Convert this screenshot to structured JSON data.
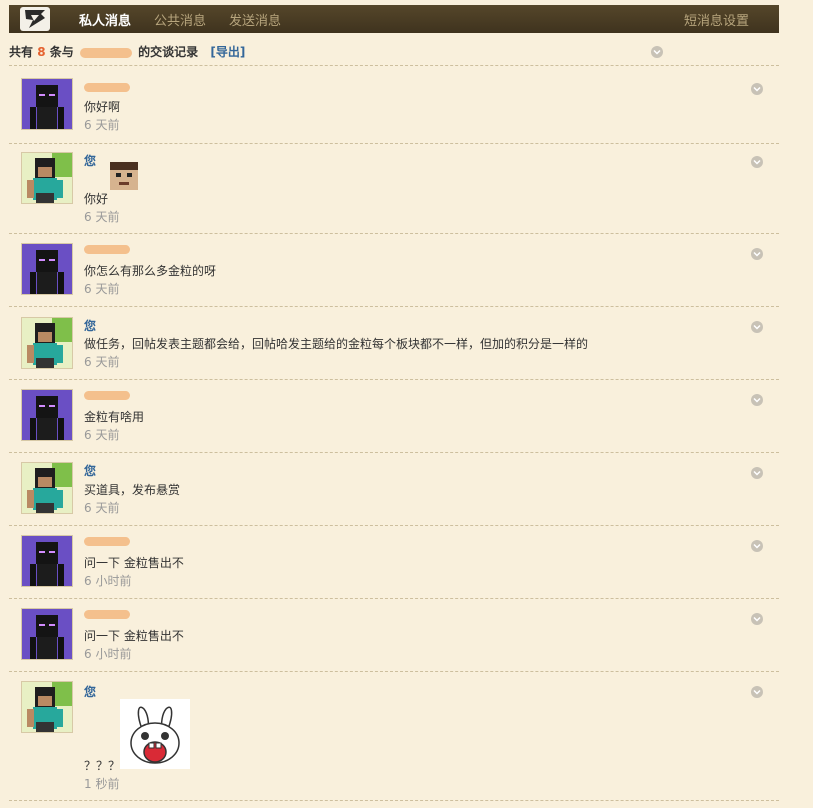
{
  "nav": {
    "tabs": [
      {
        "label": "私人消息",
        "active": true
      },
      {
        "label": "公共消息",
        "active": false
      },
      {
        "label": "发送消息",
        "active": false
      }
    ],
    "settings_label": "短消息设置"
  },
  "summary": {
    "prefix": "共有",
    "count": "8",
    "middle": "条与",
    "suffix": "的交谈记录",
    "export_label": "[导出]"
  },
  "messages": [
    {
      "sender": "",
      "sender_redacted": true,
      "avatar": "enderman-avatar",
      "text": "你好啊",
      "time": "6 天前"
    },
    {
      "sender": "您",
      "sender_redacted": false,
      "avatar": "steve-avatar",
      "text": "你好",
      "emote": "blocky-face-emote",
      "time": "6 天前"
    },
    {
      "sender": "",
      "sender_redacted": true,
      "avatar": "enderman-avatar",
      "text": "你怎么有那么多金粒的呀",
      "time": "6 天前"
    },
    {
      "sender": "您",
      "sender_redacted": false,
      "avatar": "steve-avatar",
      "text": "做任务，回帖发表主题都会给，回帖哈发主题给的金粒每个板块都不一样，但加的积分是一样的",
      "time": "6 天前"
    },
    {
      "sender": "",
      "sender_redacted": true,
      "avatar": "enderman-avatar",
      "text": "金粒有啥用",
      "time": "6 天前"
    },
    {
      "sender": "您",
      "sender_redacted": false,
      "avatar": "steve-avatar",
      "text": "买道具，发布悬赏",
      "time": "6 天前"
    },
    {
      "sender": "",
      "sender_redacted": true,
      "avatar": "enderman-avatar",
      "text": "问一下 金粒售出不",
      "time": "6 小时前"
    },
    {
      "sender": "",
      "sender_redacted": true,
      "avatar": "enderman-avatar",
      "text": "问一下 金粒售出不",
      "time": "6 小时前"
    },
    {
      "sender": "您",
      "sender_redacted": false,
      "avatar": "steve-avatar",
      "text": "？？？",
      "emote": "screaming-rabbit-emote",
      "time": "1 秒前"
    }
  ],
  "colors": {
    "page_bg": "#f9f0dc",
    "nav_bg": "#4a3d25",
    "count": "#e5622f",
    "link": "#336699",
    "muted": "#999999",
    "redaction": "#f4c08d"
  }
}
